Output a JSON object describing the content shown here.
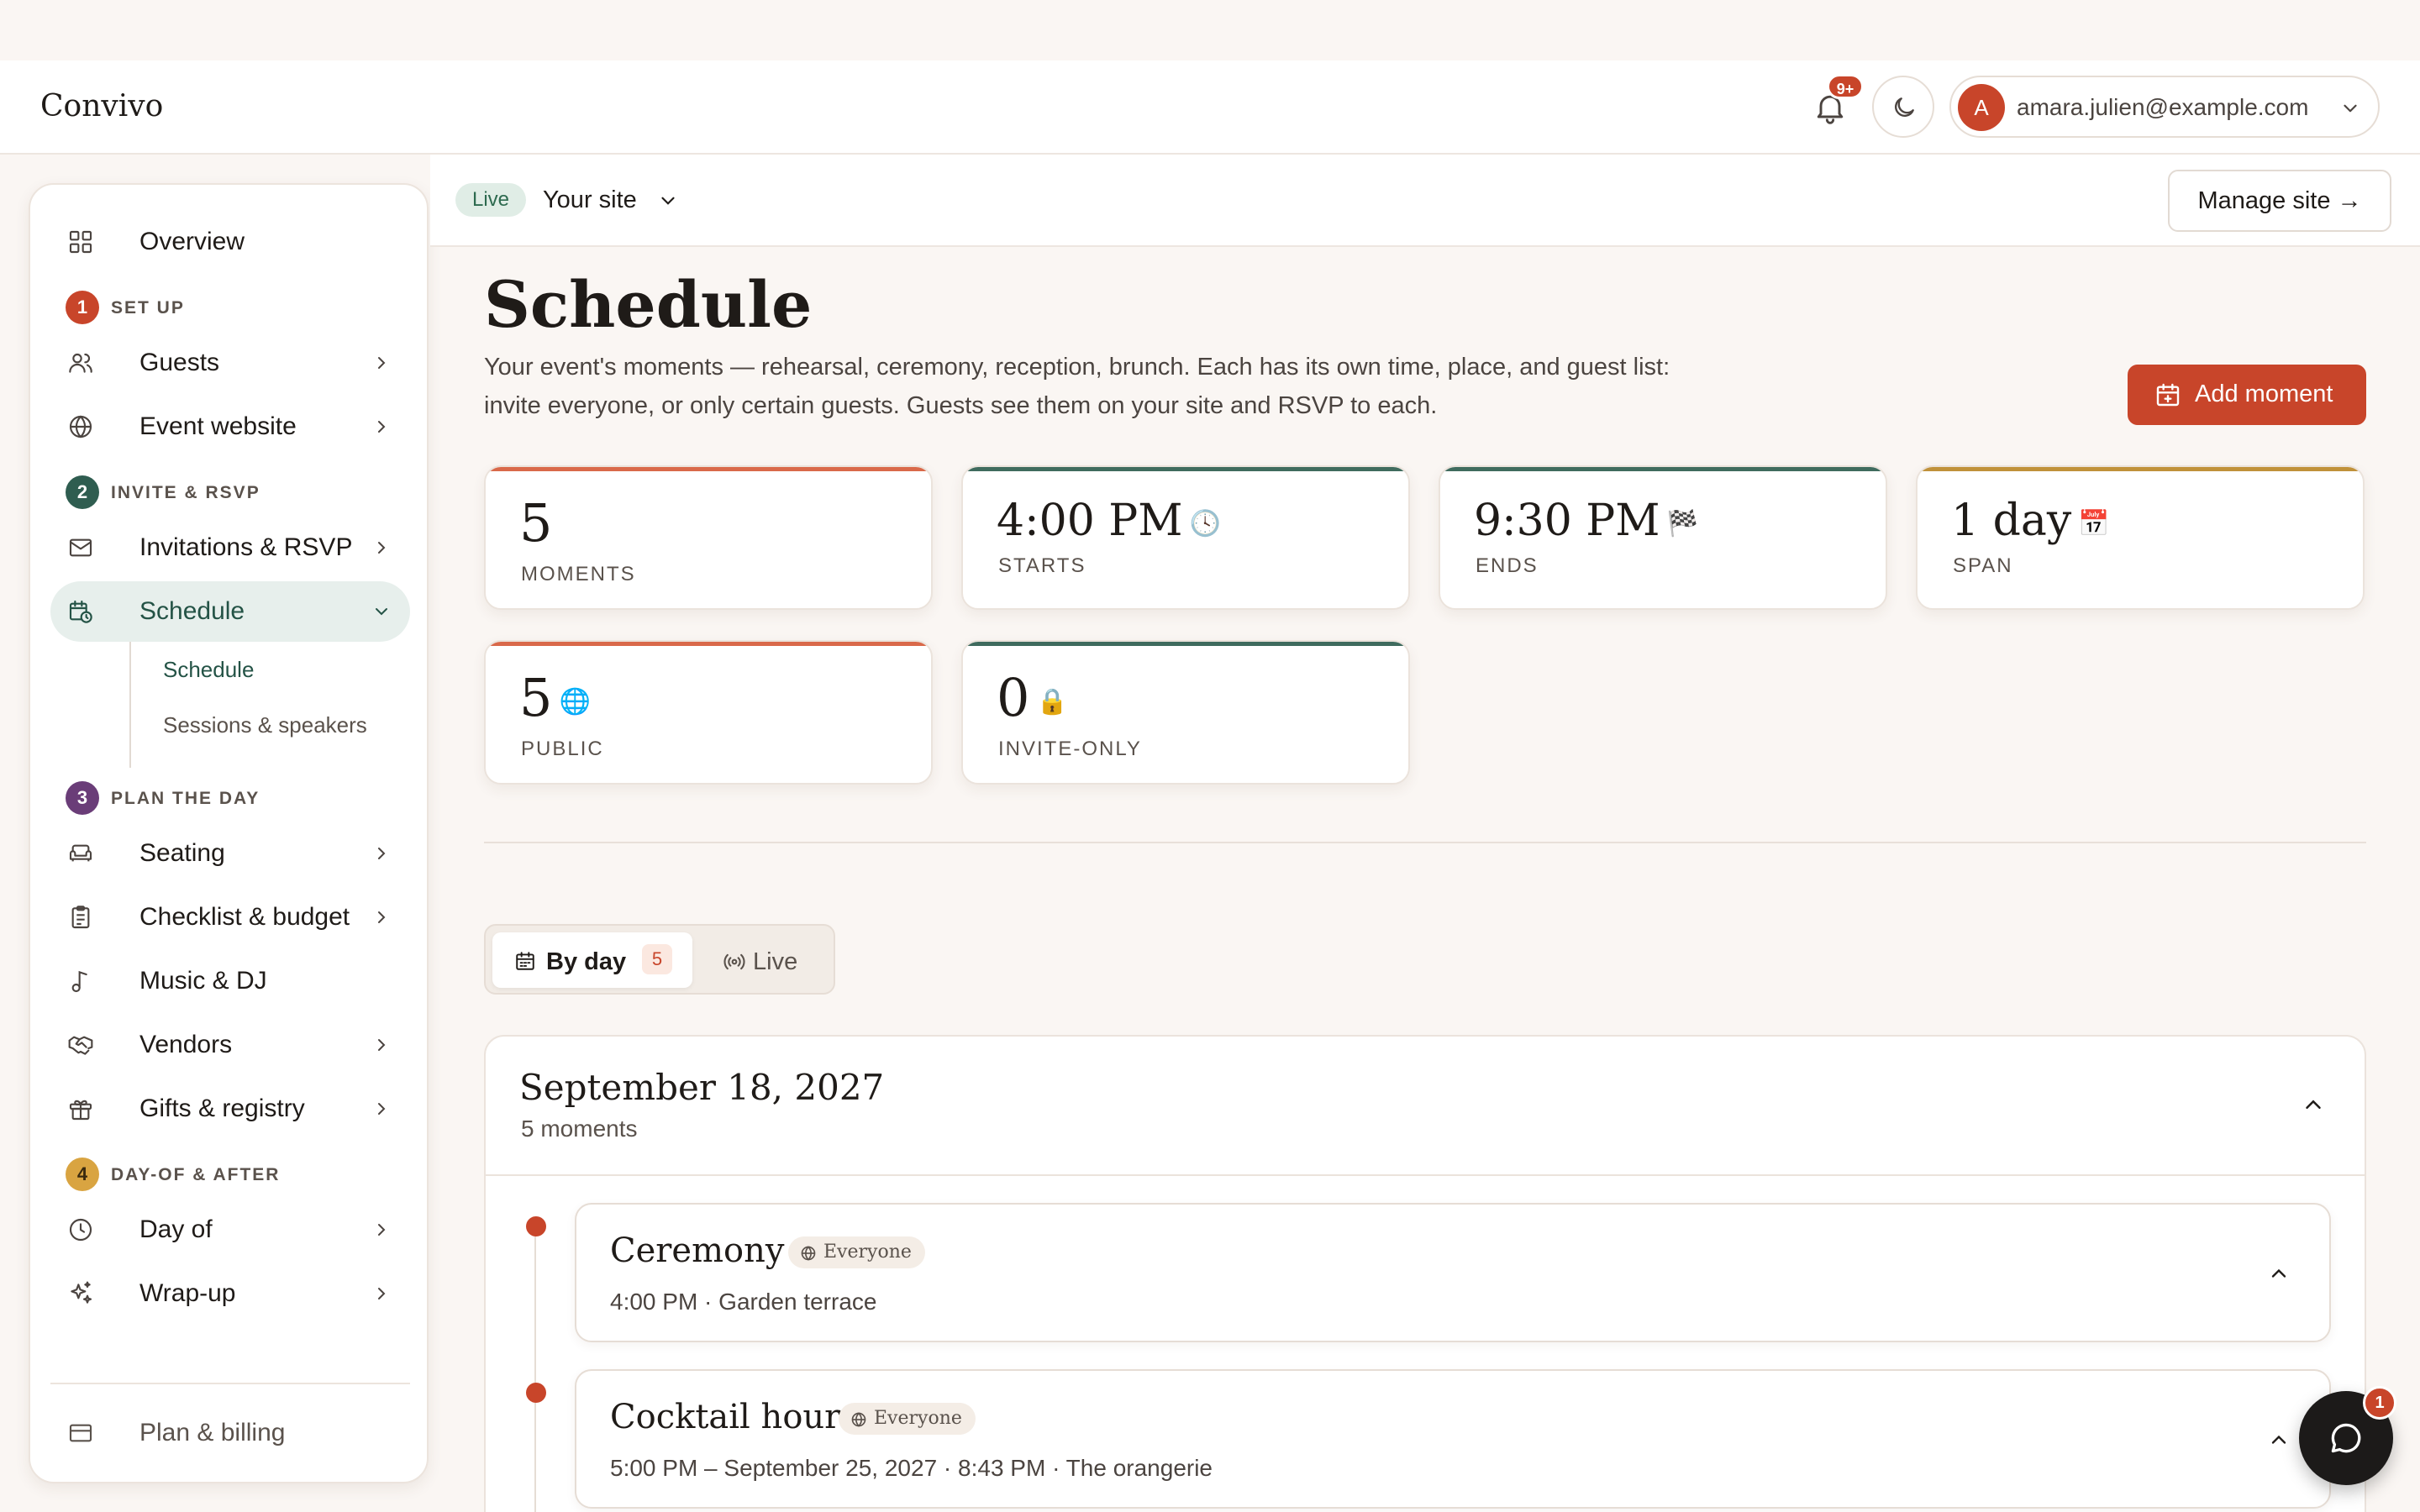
{
  "app": {
    "brand": "Convivo"
  },
  "header": {
    "notifications_badge": "9+",
    "account": {
      "avatar_initial": "A",
      "email": "amara.julien@example.com"
    }
  },
  "sidebar": {
    "overview": "Overview",
    "sections": [
      {
        "num": "1",
        "label": "SET UP",
        "color": "#c8452a"
      },
      {
        "num": "2",
        "label": "INVITE & RSVP",
        "color": "#2f5d50"
      },
      {
        "num": "3",
        "label": "PLAN THE DAY",
        "color": "#6a3d78"
      },
      {
        "num": "4",
        "label": "DAY-OF & AFTER",
        "color": "#d9a441"
      }
    ],
    "items": {
      "guests": "Guests",
      "event_website": "Event website",
      "invitations": "Invitations & RSVP",
      "schedule": "Schedule",
      "seating": "Seating",
      "checklist": "Checklist & budget",
      "music": "Music & DJ",
      "vendors": "Vendors",
      "gifts": "Gifts & registry",
      "day_of": "Day of",
      "wrap_up": "Wrap-up",
      "billing": "Plan & billing"
    },
    "schedule_sub": [
      "Schedule",
      "Sessions & speakers"
    ]
  },
  "sitebar": {
    "status": "Live",
    "site_name": "Your site",
    "manage_label": "Manage site →"
  },
  "page": {
    "title": "Schedule",
    "description": "Your event's moments — rehearsal, ceremony, reception, brunch. Each has its own time, place, and guest list: invite everyone, or only certain guests. Guests see them on your site and RSVP to each.",
    "add_label": "Add moment"
  },
  "stats": [
    {
      "value": "5",
      "emoji": "",
      "caption": "MOMENTS",
      "accent": "#d9694a"
    },
    {
      "value": "4:00 PM",
      "emoji": "🕓",
      "caption": "STARTS",
      "accent": "#3f6b5e"
    },
    {
      "value": "9:30 PM",
      "emoji": "🏁",
      "caption": "ENDS",
      "accent": "#3f6b5e"
    },
    {
      "value": "1 day",
      "emoji": "📅",
      "caption": "SPAN",
      "accent": "#c0913a"
    },
    {
      "value": "5",
      "emoji": "🌐",
      "caption": "PUBLIC",
      "accent": "#d9694a"
    },
    {
      "value": "0",
      "emoji": "🔒",
      "caption": "INVITE-ONLY",
      "accent": "#3f6b5e"
    }
  ],
  "tabs": {
    "by_day": "By day",
    "by_day_count": "5",
    "live": "Live"
  },
  "day": {
    "date": "September 18, 2027",
    "count_label": "5 moments"
  },
  "moments": [
    {
      "title": "Ceremony",
      "audience": "Everyone",
      "meta": "4:00 PM · Garden terrace"
    },
    {
      "title": "Cocktail hour",
      "audience": "Everyone",
      "meta": "5:00 PM – September 25, 2027 · 8:43 PM · The orangerie"
    }
  ],
  "chat": {
    "badge": "1"
  }
}
